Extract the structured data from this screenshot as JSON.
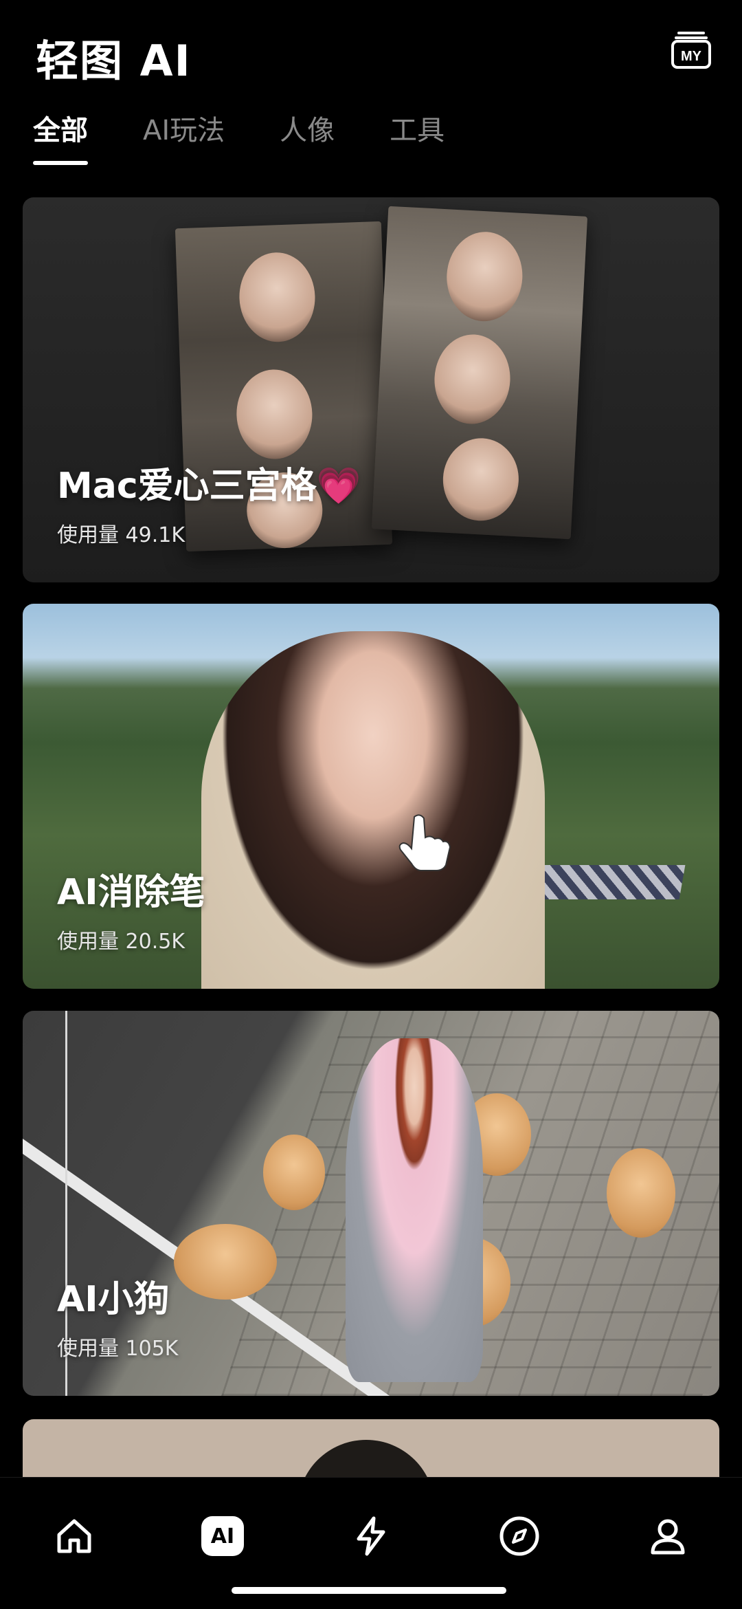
{
  "header": {
    "title": "轻图 AI",
    "my_label": "MY"
  },
  "tabs": [
    {
      "label": "全部",
      "active": true
    },
    {
      "label": "AI玩法",
      "active": false
    },
    {
      "label": "人像",
      "active": false
    },
    {
      "label": "工具",
      "active": false
    }
  ],
  "cards": [
    {
      "title": "Mac爱心三宫格",
      "title_emoji": "💗",
      "usage": "使用量 49.1K"
    },
    {
      "title": "AI消除笔",
      "usage": "使用量 20.5K"
    },
    {
      "title": "AI小狗",
      "usage": "使用量 105K"
    }
  ],
  "bottom_nav": {
    "items": [
      {
        "icon": "home-icon"
      },
      {
        "icon": "ai-icon",
        "label": "AI",
        "active": true
      },
      {
        "icon": "lightning-icon"
      },
      {
        "icon": "compass-icon"
      },
      {
        "icon": "profile-icon"
      }
    ]
  },
  "colors": {
    "background": "#000000",
    "tab_inactive": "#8a8a8a",
    "active": "#ffffff",
    "heart": "#ff4f9a"
  }
}
